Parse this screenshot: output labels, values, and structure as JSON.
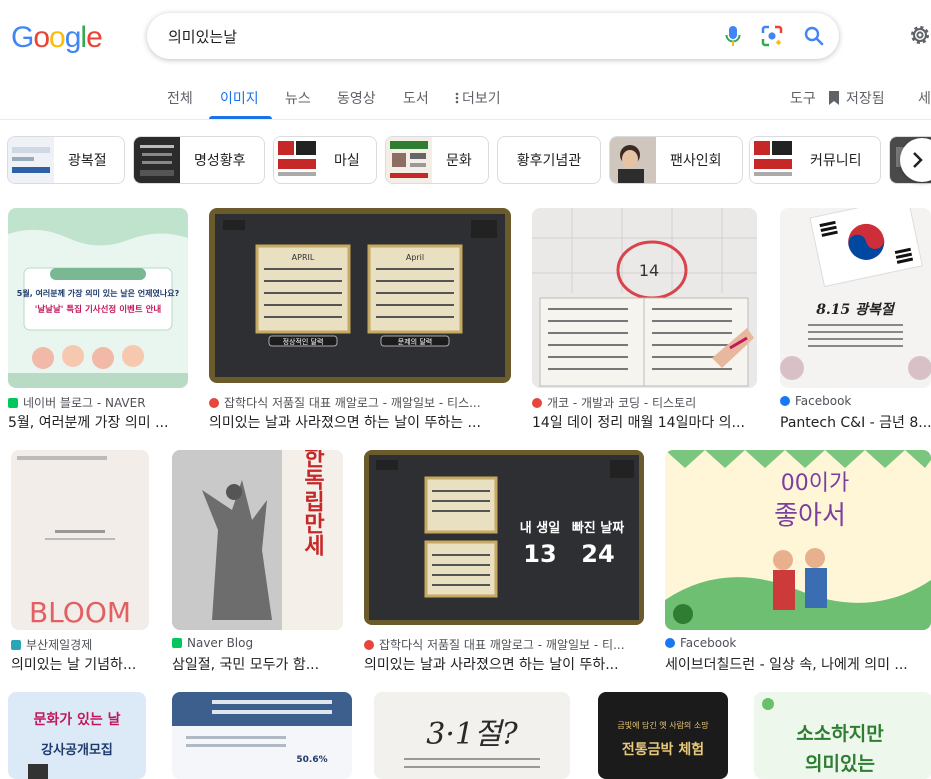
{
  "logo": {
    "text": [
      "G",
      "o",
      "o",
      "g",
      "l",
      "e"
    ],
    "colors": [
      "#4285f4",
      "#ea4335",
      "#fbbc05",
      "#4285f4",
      "#34a853",
      "#ea4335"
    ]
  },
  "search": {
    "query": "의미있는날"
  },
  "tabs": [
    "전체",
    "이미지",
    "뉴스",
    "동영상",
    "도서",
    "더보기"
  ],
  "active_tab": "이미지",
  "tools": {
    "tools": "도구",
    "saved": "저장됨",
    "more": "세"
  },
  "chips": [
    "광복절",
    "명성황후",
    "마실",
    "문화",
    "황후기념관",
    "팬사인회",
    "커뮤니티"
  ],
  "results": [
    {
      "source": "네이버 블로그 - NAVER",
      "title": "5월, 여러분께 가장 의미 ...",
      "favicon": "#03c75a",
      "art": [
        "5월, 여러분께 가장 의미 있는 날은 언제였나요?",
        "'날날날' 특집 기사선정 이벤트 안내"
      ]
    },
    {
      "source": "잡학다식 저품질 대표 깨알로그 - 깨알일보 - 티스...",
      "title": "의미있는 날과 사라졌으면 하는 날이 뚜하는 ...",
      "favicon": "#e8453c",
      "art": [
        "APRIL",
        "April",
        "정상적인 달력",
        "문제의 달력"
      ]
    },
    {
      "source": "개코 - 개발과 코딩 - 티스토리",
      "title": "14일 데이 정리 매월 14일마다 의...",
      "favicon": "#e8453c",
      "art": [
        "14"
      ]
    },
    {
      "source": "Facebook",
      "title": "Pantech C&I - 금년 8...",
      "favicon": "#1877f2",
      "art": [
        "8.15 광복절"
      ]
    },
    {
      "source": "부산제일경제",
      "title": "의미있는 날 기념하...",
      "favicon": "#2aa6b8",
      "art": [
        "BLOOM"
      ]
    },
    {
      "source": "Naver Blog",
      "title": "삼일절, 국민 모두가 함...",
      "favicon": "#03c75a",
      "art": [
        "대한독립만세"
      ]
    },
    {
      "source": "잡학다식 저품질 대표 깨알로그 - 깨알일보 - 티...",
      "title": "의미있는 날과 사라졌으면 하는 날이 뚜하...",
      "favicon": "#e8453c",
      "art": [
        "내 생일",
        "빠진 날짜",
        "13",
        "24"
      ]
    },
    {
      "source": "Facebook",
      "title": "세이브더칠드런 - 일상 속, 나에게 의미 ...",
      "favicon": "#1877f2",
      "art": [
        "00이가",
        "좋아서"
      ]
    },
    {
      "source": "",
      "title": "",
      "favicon": "",
      "art": [
        "문화가 있는 날",
        "강사공개모집"
      ]
    },
    {
      "source": "",
      "title": "",
      "favicon": "",
      "art": [
        "50.6%"
      ]
    },
    {
      "source": "",
      "title": "",
      "favicon": "",
      "art": [
        "3·1절?"
      ]
    },
    {
      "source": "",
      "title": "",
      "favicon": "",
      "art": [
        "금빛에 담긴 옛 사람의 소망",
        "전통금박 체험"
      ]
    },
    {
      "source": "",
      "title": "",
      "favicon": "",
      "art": [
        "소소하지만",
        "의미있는"
      ]
    }
  ]
}
